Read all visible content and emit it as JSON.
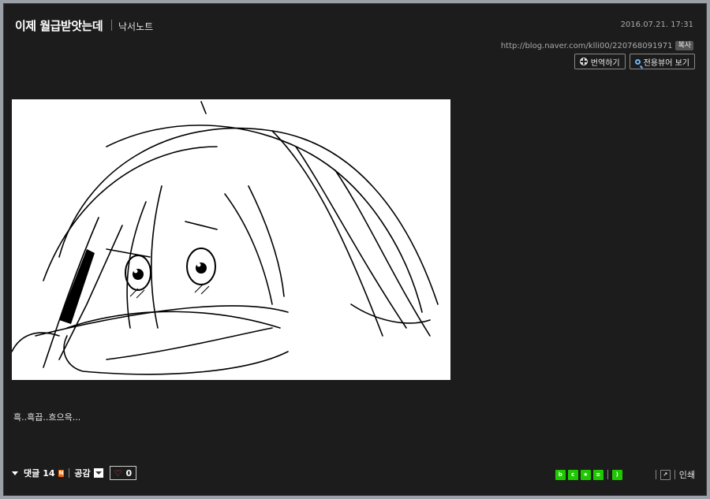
{
  "post": {
    "title": "이제 월급받앗는데",
    "category": "낙서노트",
    "date": "2016.07.21. 17:31",
    "url": "http://blog.naver.com/klli00/220768091971",
    "copy_label": "복사",
    "translate_label": "번역하기",
    "viewer_label": "전용뷰어 보기",
    "body_text": "흑..흑끕..흐으윽..."
  },
  "footer": {
    "comment_label": "댓글",
    "comment_count": "14",
    "new_badge": "N",
    "like_label": "공감",
    "like_count": "0",
    "print_label": "인쇄"
  },
  "share_icons": [
    {
      "name": "blog-share-icon",
      "color": "#1ec800"
    },
    {
      "name": "cafe-share-icon",
      "color": "#1ec800"
    },
    {
      "name": "bookmark-star-icon",
      "color": "#1ec800"
    },
    {
      "name": "memo-list-icon",
      "color": "#1ec800"
    },
    {
      "name": "rss-icon",
      "color": "#1ec800"
    },
    {
      "name": "external-share-icon",
      "color": "#1c1c1c"
    }
  ],
  "colors": {
    "background": "#1c1c1c",
    "accent_green": "#1ec800",
    "heart": "#ff4b5c"
  }
}
